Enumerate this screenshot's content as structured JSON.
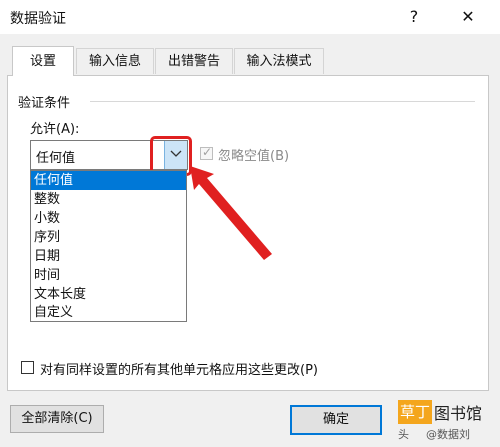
{
  "window": {
    "title": "数据验证",
    "help": "?",
    "close": "✕"
  },
  "tabs": [
    {
      "label": "设置",
      "active": true
    },
    {
      "label": "输入信息",
      "active": false
    },
    {
      "label": "出错警告",
      "active": false
    },
    {
      "label": "输入法模式",
      "active": false
    }
  ],
  "group": {
    "label": "验证条件"
  },
  "allow": {
    "label": "允许(A):",
    "selected": "任何值",
    "options": [
      "任何值",
      "整数",
      "小数",
      "序列",
      "日期",
      "时间",
      "文本长度",
      "自定义"
    ]
  },
  "ignore_blank": {
    "label": "忽略空值(B)",
    "checked": true,
    "enabled": false
  },
  "apply_all": {
    "label": "对有同样设置的所有其他单元格应用这些更改(P)",
    "checked": false
  },
  "buttons": {
    "clear_all": "全部清除(C)",
    "ok": "确定"
  },
  "watermark": {
    "badge": "草丁",
    "text": "图书馆",
    "prefix": "头",
    "sub": "@数据刘"
  },
  "colors": {
    "accent": "#0078d7",
    "highlight": "#e02020"
  }
}
